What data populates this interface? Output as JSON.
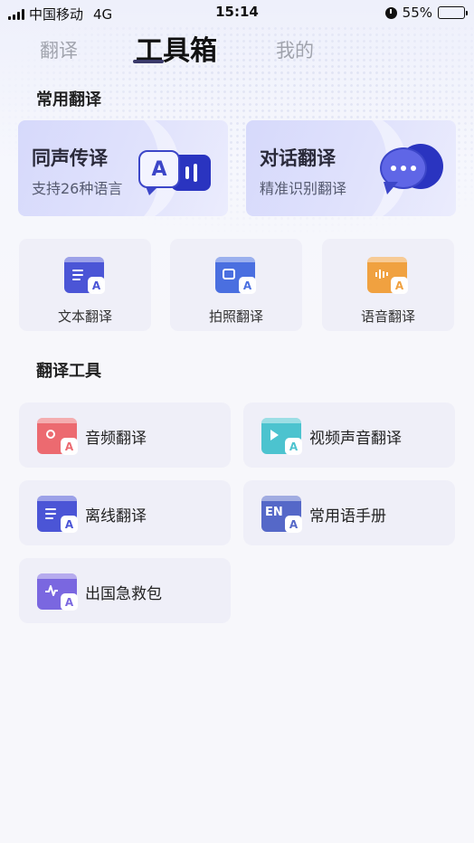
{
  "status_bar": {
    "carrier": "中国移动",
    "network": "4G",
    "time": "15:14",
    "battery": "55%",
    "battery_level": 0.55
  },
  "top_tabs": [
    {
      "label": "翻译",
      "active": false
    },
    {
      "label": "工具箱",
      "active": true
    },
    {
      "label": "我的",
      "active": false
    }
  ],
  "common_section": {
    "title": "常用翻译",
    "big_cards": [
      {
        "title": "同声传译",
        "subtitle": "支持26种语言",
        "icon": "simultaneous-interpretation-icon",
        "badge_letter": "A"
      },
      {
        "title": "对话翻译",
        "subtitle": "精准识别翻译",
        "icon": "chat-bubbles-icon"
      }
    ],
    "small_cards": [
      {
        "label": "文本翻译",
        "icon": "text-translate-icon",
        "color": "#4b55d6",
        "badge_letter": "A"
      },
      {
        "label": "拍照翻译",
        "icon": "photo-translate-icon",
        "color": "#4a6fe0",
        "badge_letter": "A"
      },
      {
        "label": "语音翻译",
        "icon": "voice-translate-icon",
        "color": "#f0a140",
        "badge_letter": "A"
      }
    ]
  },
  "tools_section": {
    "title": "翻译工具",
    "items": [
      {
        "label": "音频翻译",
        "icon": "audio-translate-icon",
        "color": "#ec6a70",
        "badge_letter": "A"
      },
      {
        "label": "视频声音翻译",
        "icon": "video-translate-icon",
        "color": "#4cc3cf",
        "badge_letter": "A"
      },
      {
        "label": "离线翻译",
        "icon": "offline-translate-icon",
        "color": "#4b55d6",
        "badge_letter": "A"
      },
      {
        "label": "常用语手册",
        "icon": "phrasebook-icon",
        "color": "#5568c8",
        "badge_letter": "A",
        "mark": "EN"
      },
      {
        "label": "出国急救包",
        "icon": "emergency-kit-icon",
        "color": "#7a67e0",
        "badge_letter": "A"
      }
    ]
  }
}
